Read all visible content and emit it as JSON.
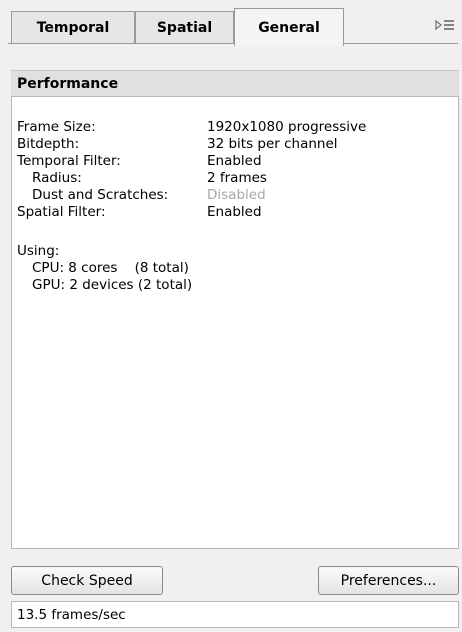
{
  "tabs": [
    {
      "label": "Temporal",
      "active": false
    },
    {
      "label": "Spatial",
      "active": false
    },
    {
      "label": "General",
      "active": true
    }
  ],
  "panel_menu_icon": "panel-menu-icon",
  "section": {
    "title": "Performance"
  },
  "info": {
    "rows": [
      {
        "label": "Frame Size:",
        "value": "1920x1080 progressive"
      },
      {
        "label": "Bitdepth:",
        "value": "32 bits per channel"
      },
      {
        "label": "Temporal Filter:",
        "value": "Enabled"
      },
      {
        "label": "Radius:",
        "value": "2 frames"
      },
      {
        "label": "Dust and Scratches:",
        "value": "Disabled"
      },
      {
        "label": "Spatial Filter:",
        "value": "Enabled"
      }
    ],
    "using_label": "Using:",
    "cpu": "CPU: 8 cores    (8 total)",
    "gpu": "GPU: 2 devices (2 total)"
  },
  "buttons": {
    "check_speed": "Check Speed",
    "preferences": "Preferences..."
  },
  "status": {
    "text": "13.5 frames/sec"
  },
  "colors": {
    "disabled_text": "#a8a8a8",
    "panel_bg": "#f0f0f0"
  }
}
